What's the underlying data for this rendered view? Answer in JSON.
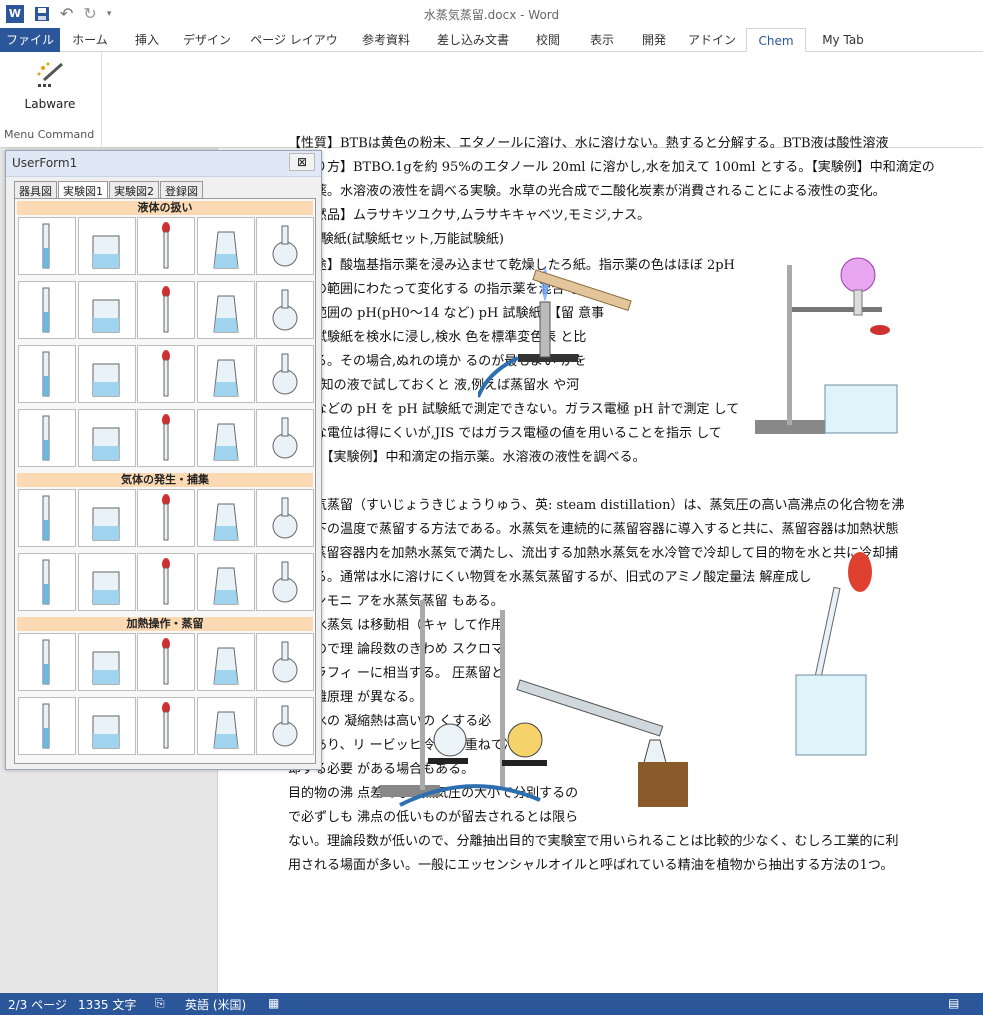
{
  "app": {
    "title": "水蒸気蒸留.docx - Word"
  },
  "qat": {
    "undo_glyph": "↶",
    "redo_glyph": "↻"
  },
  "ribbon_tabs": [
    "ファイル",
    "ホーム",
    "挿入",
    "デザイン",
    "ページ レイアウト",
    "参考資料",
    "差し込み文書",
    "校閲",
    "表示",
    "開発",
    "アドイン",
    "Chem",
    "My Tab"
  ],
  "ribbon": {
    "labware_label": "Labware",
    "group_label": "Menu Command"
  },
  "userform": {
    "title": "UserForm1",
    "close_glyph": "⊠",
    "tabs": [
      "器具図",
      "実験図1",
      "実験図2",
      "登録図"
    ],
    "active_tab": "実験図1",
    "sections": [
      "液体の扱い",
      "気体の発生・捕集",
      "加熱操作・蒸留"
    ]
  },
  "document": {
    "lines": [
      "【性質】BTBは黄色の粉末、エタノールに溶け、水に溶けない。熱すると分解する。BTB液は酸性溶液",
      "【作り方】BTBO.1gを約 95%のエタノール 20ml に溶かし,水を加えて 100ml とする。【実験例】中和滴定の",
      "指示薬。水溶液の液性を調べる実験。水草の光合成で二酸化炭素が消費されることによる液性の変化。",
      "【天然品】ムラサキツユクサ,ムラサキキャベツ,モミジ,ナス。",
      "pH試験紙(試験紙セット,万能試験紙)",
      "【用途】酸塩基指示薬を浸み込ませて乾燥したろ紙。指示薬の色はほぼ                                    2pH",
      "程度の範囲にわたって変化する                              の指示薬を混合                              し、",
      "広い範囲の pH(pH0～14 など)                              pH 試験紙。【留                            意事",
      "項】試験紙を検水に浸し,検水                              色を標準変色表                            と比",
      "較する。その場合,ぬれの境か                              るのが最もよい                            かを",
      "pH既知の液で試しておくと                               液,例えば蒸留水                            や河",
      "川水などの pH を pH 試験紙で測定できない。ガラス電極 pH 計で測定                                  して",
      "安定な電位は得にくいが,JIS ではガラス電極の値を用いることを指示                                      して",
      "いる。【実験例】中和滴定の指示薬。水溶液の液性を調べる。",
      "",
      "水蒸気蒸留（すいじょうきじょうりゅう、英: steam distillation）は、蒸気圧の高い高沸点の化合物を沸",
      "点以下の温度で蒸留する方法である。水蒸気を連続的に蒸留容器に導入すると共に、蒸留容器は加熱状態",
      "で、蒸留容器内を加熱水蒸気で満たし、流出する加熱水蒸気を水冷管で冷却して目的物を水と共に冷却捕",
      "集する。通常は水に溶けにくい物質を水蒸気蒸留するが、旧式のアミノ酸定量法                   解産成し",
      "たアンモニ                                                         アを水蒸気蒸留                       もある。",
      "また水蒸気                                                         は移動相（キャ                      して作用",
      "するので理                                                         論段数のきわめ                      スクロマ",
      "トグラフィ                                                         ーに相当する。                      圧蒸留と",
      "は分離原理                                                         が異なる。",
      "特に水の                                                          凝縮熱は高いの                       くする必",
      "要があり、リ                                                        ービッヒ冷却器                       重ねて冷",
      "却する必要                                                         がある場合もある。",
      "目的物の沸                                                         点差でなく蒸気圧の大小で分別するの",
      "で必ずしも                                                         沸点の低いものが留去されるとは限ら",
      "ない。理論段数が低いので、分離抽出目的で実験室で用いられることは比較的少なく、むしろ工業的に利",
      "用される場面が多い。一般にエッセンシャルオイルと呼ばれている精油を植物から抽出する方法の1つ。"
    ]
  },
  "status": {
    "page": "2/3 ページ",
    "words": "1335 文字",
    "language": "英語 (米国)"
  },
  "colors": {
    "accent": "#2b579a",
    "section_header": "#fbd9b3"
  }
}
